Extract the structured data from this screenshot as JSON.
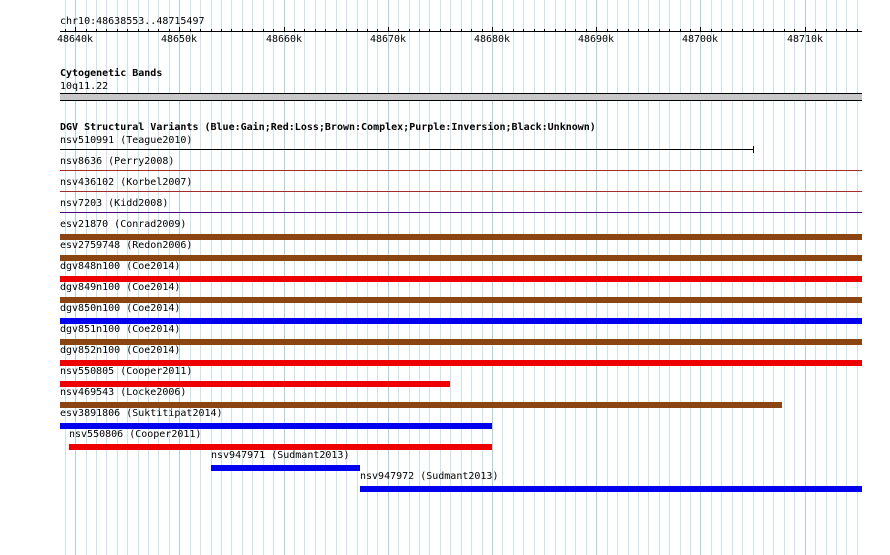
{
  "ruler": {
    "coordinates": "chr10:48638553..48715497",
    "start": 48638553,
    "end": 48715497,
    "tick_labels": [
      "48640k",
      "48650k",
      "48660k",
      "48670k",
      "48680k",
      "48690k",
      "48700k",
      "48710k"
    ],
    "tick_values": [
      48640000,
      48650000,
      48660000,
      48670000,
      48680000,
      48690000,
      48700000,
      48710000
    ]
  },
  "cytoband_track": {
    "title": "Cytogenetic Bands",
    "band_label": "10q11.22",
    "band_color": "#c8c8c8"
  },
  "dgv_track": {
    "title": "DGV Structural Variants (Blue:Gain;Red:Loss;Brown:Complex;Purple:Inversion;Black:Unknown)",
    "colors": {
      "gain": "#0000ee",
      "loss": "#ee0000",
      "complex": "#8b4513",
      "inversion": "#4b0082",
      "unknown": "#000000",
      "loss_thin": "#a52a2a"
    },
    "features": [
      {
        "label": "nsv510991 (Teague2010)",
        "start": 48638553,
        "end": 48705000,
        "type": "unknown",
        "style": "line-end"
      },
      {
        "label": "nsv8636 (Perry2008)",
        "start": 48638553,
        "end": 48715497,
        "type": "loss_thin",
        "style": "thin"
      },
      {
        "label": "nsv436102 (Korbel2007)",
        "start": 48638553,
        "end": 48715497,
        "type": "loss_thin",
        "style": "thin"
      },
      {
        "label": "nsv7203 (Kidd2008)",
        "start": 48638553,
        "end": 48715497,
        "type": "inversion",
        "style": "thin"
      },
      {
        "label": "esv21870 (Conrad2009)",
        "start": 48638553,
        "end": 48715497,
        "type": "complex",
        "style": "thick"
      },
      {
        "label": "esv2759748 (Redon2006)",
        "start": 48638553,
        "end": 48715497,
        "type": "complex",
        "style": "thick"
      },
      {
        "label": "dgv848n100 (Coe2014)",
        "start": 48638553,
        "end": 48715497,
        "type": "loss",
        "style": "thick"
      },
      {
        "label": "dgv849n100 (Coe2014)",
        "start": 48638553,
        "end": 48715497,
        "type": "complex",
        "style": "thick"
      },
      {
        "label": "dgv850n100 (Coe2014)",
        "start": 48638553,
        "end": 48715497,
        "type": "gain",
        "style": "thick"
      },
      {
        "label": "dgv851n100 (Coe2014)",
        "start": 48638553,
        "end": 48715497,
        "type": "complex",
        "style": "thick"
      },
      {
        "label": "dgv852n100 (Coe2014)",
        "start": 48638553,
        "end": 48715497,
        "type": "loss",
        "style": "thick"
      },
      {
        "label": "nsv550805 (Cooper2011)",
        "start": 48638553,
        "end": 48676000,
        "type": "loss",
        "style": "thick"
      },
      {
        "label": "nsv469543 (Locke2006)",
        "start": 48638553,
        "end": 48707800,
        "type": "complex",
        "style": "thick"
      },
      {
        "label": "esv3891806 (Suktitipat2014)",
        "start": 48638553,
        "end": 48680000,
        "type": "gain",
        "style": "thick"
      },
      {
        "label": "nsv550806 (Cooper2011)",
        "start": 48639400,
        "end": 48680000,
        "type": "loss",
        "style": "thick"
      },
      {
        "label": "nsv947971 (Sudmant2013)",
        "start": 48653000,
        "end": 48667300,
        "type": "gain",
        "style": "thick"
      },
      {
        "label": "nsv947972 (Sudmant2013)",
        "start": 48667300,
        "end": 48715497,
        "type": "gain",
        "style": "thick"
      }
    ]
  }
}
